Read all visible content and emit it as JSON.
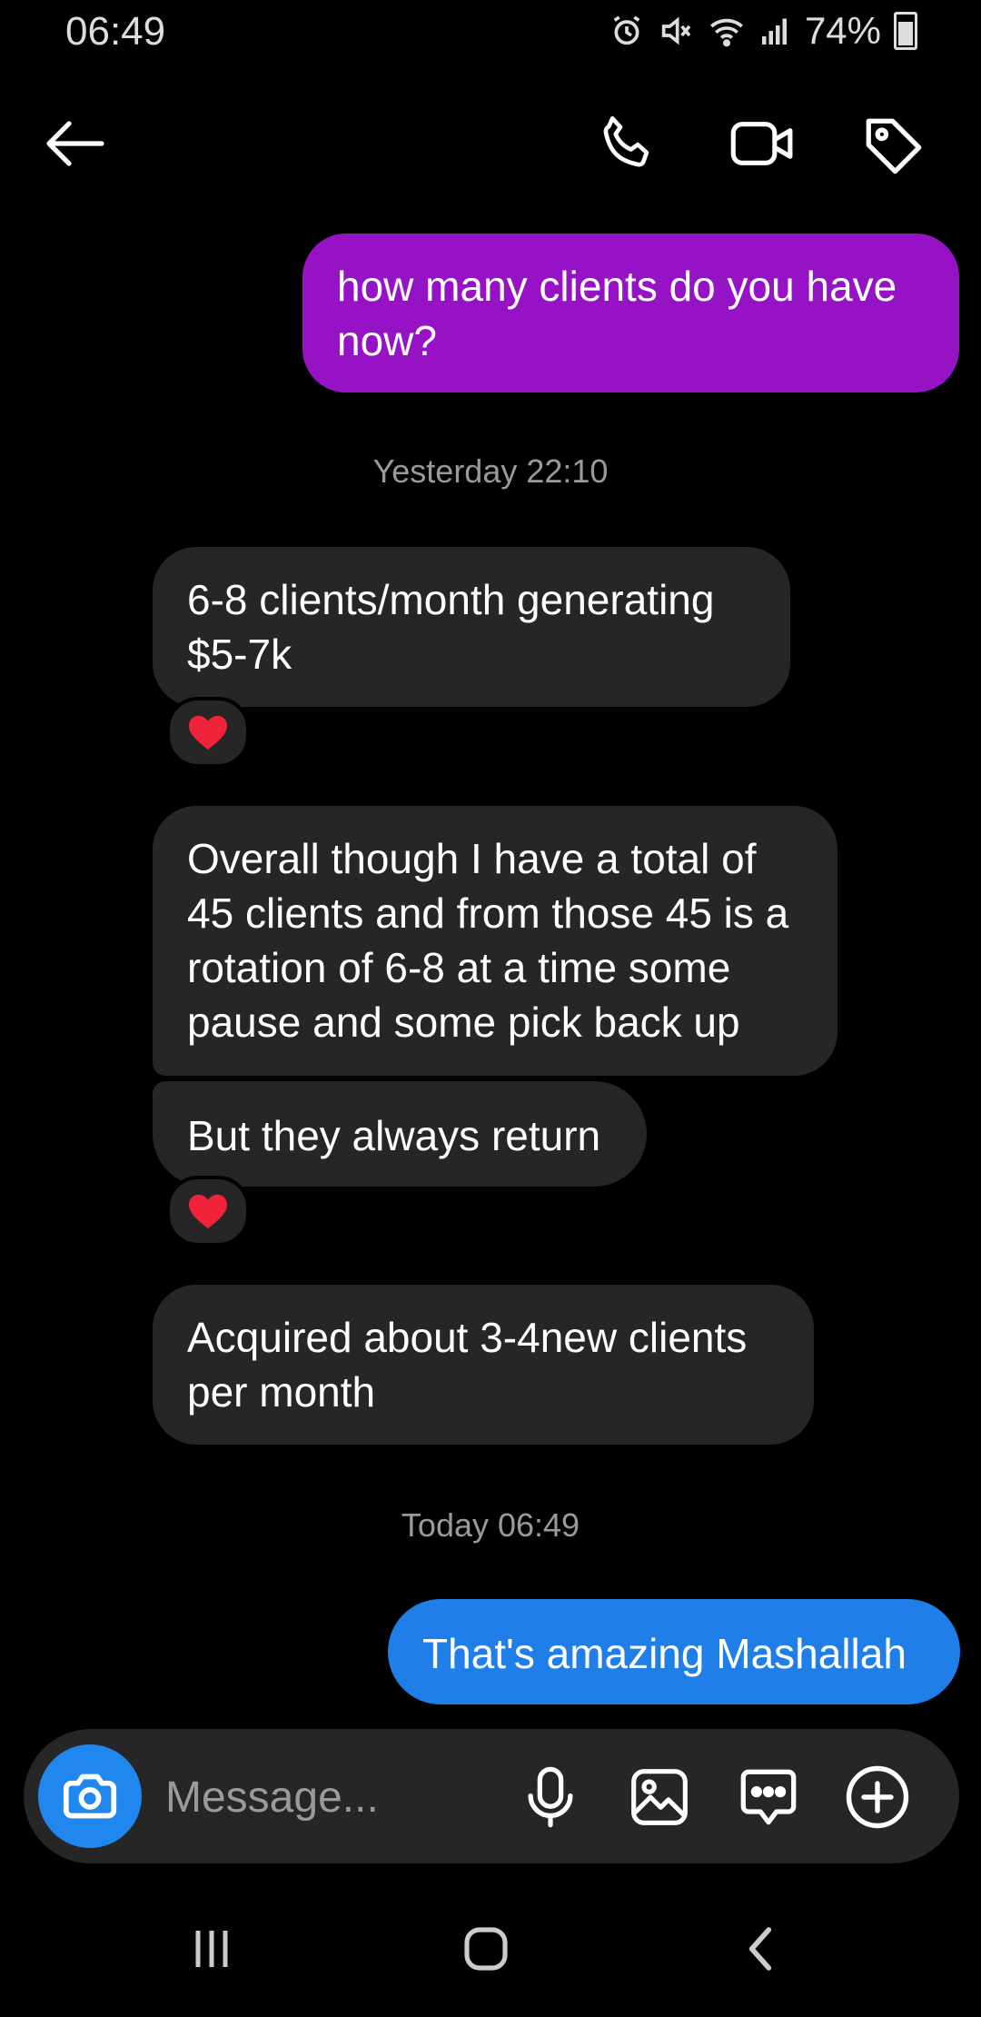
{
  "status_bar": {
    "time": "06:49",
    "battery": "74%",
    "icons": [
      "alarm-icon",
      "mute-icon",
      "wifi-icon",
      "signal-icon",
      "battery-icon"
    ]
  },
  "header": {
    "icons": [
      "back-arrow-icon",
      "phone-icon",
      "video-icon",
      "tag-icon"
    ]
  },
  "messages": [
    {
      "from": "me",
      "text": "how many clients do you have now?",
      "color": "#9613c5"
    },
    {
      "timestamp": "Yesterday 22:10"
    },
    {
      "from": "them",
      "text": "6-8 clients/month generating $5-7k",
      "reaction": "❤️"
    },
    {
      "from": "them",
      "text": "Overall though I have a total of 45 clients and from those 45 is a rotation of 6-8 at a time some pause and some pick back up"
    },
    {
      "from": "them",
      "text": "But they always return",
      "reaction": "❤️"
    },
    {
      "from": "them",
      "text": "Acquired about 3-4new clients per month"
    },
    {
      "timestamp": "Today 06:49"
    },
    {
      "from": "me",
      "text": "That's amazing Mashallah",
      "color": "#1f7ee8"
    }
  ],
  "composer": {
    "placeholder": "Message...",
    "icons": [
      "camera-icon",
      "microphone-icon",
      "gallery-icon",
      "sticker-icon",
      "plus-icon"
    ]
  },
  "nav_bar": {
    "icons": [
      "recent-apps-icon",
      "home-icon",
      "back-icon"
    ]
  },
  "colors": {
    "background": "#000000",
    "incoming_bubble": "#262626",
    "accent_blue": "#1f87ee"
  }
}
